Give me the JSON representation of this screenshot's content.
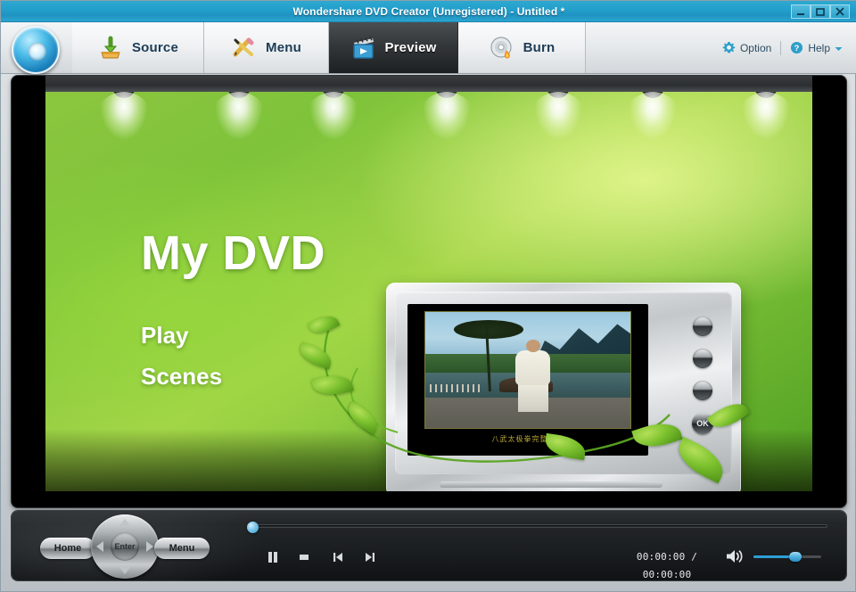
{
  "window": {
    "title": "Wondershare DVD Creator (Unregistered) - Untitled *",
    "minimize_label": "Minimize",
    "maximize_label": "Maximize",
    "close_label": "Close",
    "accent_color": "#22a0cc"
  },
  "toolbar": {
    "tabs": [
      {
        "id": "source",
        "label": "Source",
        "icon": "download-tray-icon",
        "active": false
      },
      {
        "id": "menu",
        "label": "Menu",
        "icon": "pencil-tools-icon",
        "active": false
      },
      {
        "id": "preview",
        "label": "Preview",
        "icon": "film-clapper-play-icon",
        "active": true
      },
      {
        "id": "burn",
        "label": "Burn",
        "icon": "disc-flame-icon",
        "active": false
      }
    ],
    "option_label": "Option",
    "help_label": "Help",
    "logo_name": "wondershare-disc-logo"
  },
  "preview": {
    "menu_title": "My DVD",
    "menu_items": [
      "Play",
      "Scenes"
    ],
    "lamp_count": 7,
    "background_colors": {
      "green_light": "#a6d64a",
      "green_mid": "#8cc63f",
      "green_dark": "#4f9e22"
    },
    "tv": {
      "caption": "八武太极拳完整示范",
      "ok_label": "OK",
      "knob_count": 3
    }
  },
  "controls": {
    "home_label": "Home",
    "enter_label": "Enter",
    "menu_label": "Menu",
    "dpad_name": "dvd-navigation-dpad",
    "transport": [
      {
        "id": "pause",
        "label": "Pause"
      },
      {
        "id": "stop",
        "label": "Stop"
      },
      {
        "id": "prev",
        "label": "Previous"
      },
      {
        "id": "next",
        "label": "Next"
      }
    ],
    "current_time": "00:00:00",
    "total_time": "00:00:00",
    "time_separator": "/",
    "timecode": "00:00:00 / 00:00:00",
    "seek_position_percent": 0,
    "volume_percent": 62,
    "volume_icon": "speaker-on-icon"
  }
}
